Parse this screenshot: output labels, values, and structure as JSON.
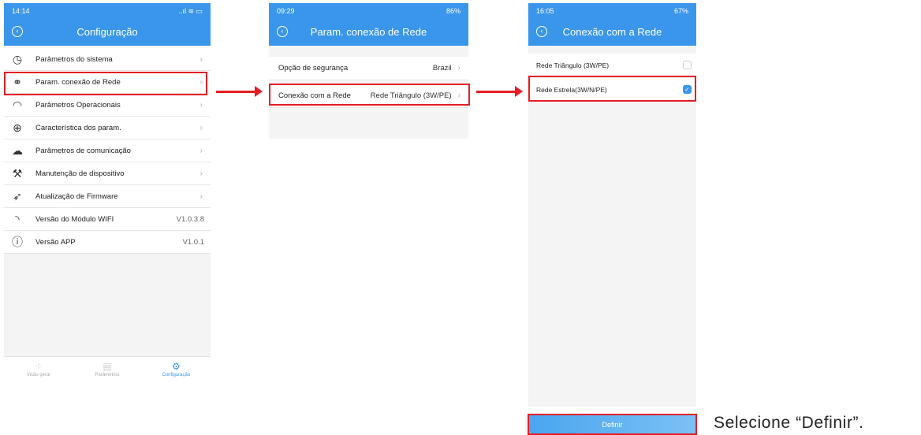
{
  "screen1": {
    "status_time": "14:14",
    "status_right": "..ıl ≋ ▭",
    "title": "Configuração",
    "items": [
      {
        "icon": "clock-icon",
        "glyph": "◷",
        "label": "Parâmetros do sistema",
        "value": ""
      },
      {
        "icon": "link-icon",
        "glyph": "⚭",
        "label": "Param. conexão de Rede",
        "value": ""
      },
      {
        "icon": "gauge-icon",
        "glyph": "◠",
        "label": "Parâmetros Operacionais",
        "value": ""
      },
      {
        "icon": "crosshair-icon",
        "glyph": "⊕",
        "label": "Característica dos param.",
        "value": ""
      },
      {
        "icon": "cloud-upload-icon",
        "glyph": "☁",
        "label": "Parâmetros de comunicação",
        "value": ""
      },
      {
        "icon": "wrench-icon",
        "glyph": "⚒",
        "label": "Manutenção de dispositivo",
        "value": ""
      },
      {
        "icon": "rocket-icon",
        "glyph": "➶",
        "label": "Atualização de Firmware",
        "value": ""
      },
      {
        "icon": "wifi-icon",
        "glyph": "◝",
        "label": "Versão do Módulo WIFI",
        "value": "V1.0.3.8"
      },
      {
        "icon": "info-icon",
        "glyph": "ⓘ",
        "label": "Versão APP",
        "value": "V1.0.1"
      }
    ],
    "tabs": [
      {
        "icon": "grid-icon",
        "glyph": "⁘",
        "label": "Visão geral"
      },
      {
        "icon": "list-icon",
        "glyph": "▤",
        "label": "Parâmetros"
      },
      {
        "icon": "gear-icon",
        "glyph": "⚙",
        "label": "Configuração"
      }
    ]
  },
  "screen2": {
    "status_time": "09:29",
    "status_right": "86%",
    "title": "Param. conexão de Rede",
    "rows": [
      {
        "label": "Opção de segurança",
        "value": "Brazil"
      },
      {
        "label": "Conexão com a Rede",
        "value": "Rede Triângulo (3W/PE)"
      }
    ]
  },
  "screen3": {
    "status_time": "16:05",
    "status_right": "67%",
    "title": "Conexão com a Rede",
    "options": [
      {
        "label": "Rede Triângulo (3W/PE)",
        "checked": false
      },
      {
        "label": "Rede Estrela(3W/N/PE)",
        "checked": true
      }
    ],
    "button_label": "Definir"
  },
  "caption": "Selecione “Definir”.",
  "colors": {
    "accent": "#3a96ea",
    "highlight": "#e51e25"
  }
}
